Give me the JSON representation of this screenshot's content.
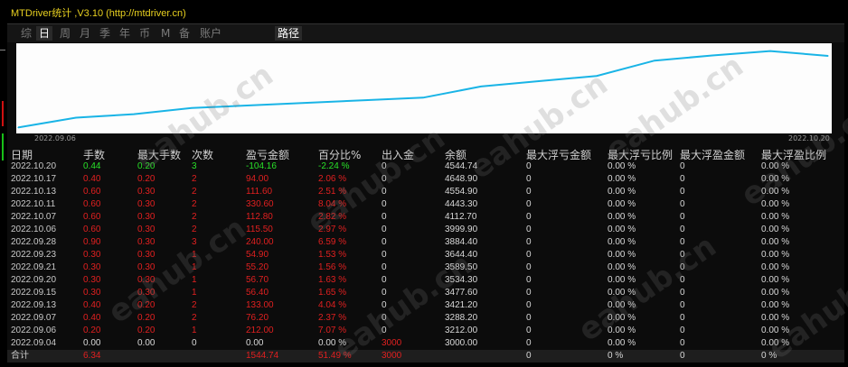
{
  "window": {
    "title": "MTDriver统计 ,V3.10 (http://mtdriver.cn)"
  },
  "tabs": [
    {
      "label": "综",
      "active": false
    },
    {
      "label": "日",
      "active": true
    },
    {
      "label": "周",
      "active": false
    },
    {
      "label": "月",
      "active": false
    },
    {
      "label": "季",
      "active": false
    },
    {
      "label": "年",
      "active": false
    },
    {
      "label": "币",
      "active": false
    },
    {
      "label": "M",
      "active": false
    },
    {
      "label": "备",
      "active": false
    },
    {
      "label": "账户",
      "active": false
    },
    {
      "label": "路径",
      "active": true
    }
  ],
  "chart": {
    "start_label": "2022.09.06",
    "end_label": "2022.10.20",
    "line_color": "#19b4e6",
    "chart_data": {
      "type": "line",
      "x": [
        "2022.09.04",
        "2022.09.06",
        "2022.09.07",
        "2022.09.13",
        "2022.09.15",
        "2022.09.20",
        "2022.09.21",
        "2022.09.23",
        "2022.09.28",
        "2022.10.06",
        "2022.10.07",
        "2022.10.11",
        "2022.10.13",
        "2022.10.17",
        "2022.10.20"
      ],
      "series": [
        {
          "values": [
            3000.0,
            3212.0,
            3288.2,
            3421.2,
            3477.6,
            3534.3,
            3589.5,
            3644.4,
            3884.4,
            3999.9,
            4112.7,
            4443.3,
            4554.9,
            4648.9,
            4544.74
          ]
        }
      ]
    }
  },
  "table": {
    "headers": [
      "日期",
      "手数",
      "最大手数",
      "次数",
      "盈亏金额",
      "百分比%",
      "出入金",
      "余额",
      "最大浮亏金额",
      "最大浮亏比例",
      "最大浮盈金额",
      "最大浮盈比例"
    ],
    "rows": [
      {
        "date": "2022.10.20",
        "lots": "0.44",
        "max_lots": "0.20",
        "count": "3",
        "pnl": "-104.16",
        "pct": "-2.24 %",
        "deposit": "0",
        "balance": "4544.74",
        "max_float_loss": "0",
        "max_float_loss_pct": "0.00 %",
        "max_float_profit": "0",
        "max_float_profit_pct": "0.00 %",
        "tone": "green"
      },
      {
        "date": "2022.10.17",
        "lots": "0.40",
        "max_lots": "0.20",
        "count": "2",
        "pnl": "94.00",
        "pct": "2.06 %",
        "deposit": "0",
        "balance": "4648.90",
        "max_float_loss": "0",
        "max_float_loss_pct": "0.00 %",
        "max_float_profit": "0",
        "max_float_profit_pct": "0.00 %",
        "tone": "red"
      },
      {
        "date": "2022.10.13",
        "lots": "0.60",
        "max_lots": "0.30",
        "count": "2",
        "pnl": "111.60",
        "pct": "2.51 %",
        "deposit": "0",
        "balance": "4554.90",
        "max_float_loss": "0",
        "max_float_loss_pct": "0.00 %",
        "max_float_profit": "0",
        "max_float_profit_pct": "0.00 %",
        "tone": "red"
      },
      {
        "date": "2022.10.11",
        "lots": "0.60",
        "max_lots": "0.30",
        "count": "2",
        "pnl": "330.60",
        "pct": "8.04 %",
        "deposit": "0",
        "balance": "4443.30",
        "max_float_loss": "0",
        "max_float_loss_pct": "0.00 %",
        "max_float_profit": "0",
        "max_float_profit_pct": "0.00 %",
        "tone": "red"
      },
      {
        "date": "2022.10.07",
        "lots": "0.60",
        "max_lots": "0.30",
        "count": "2",
        "pnl": "112.80",
        "pct": "2.82 %",
        "deposit": "0",
        "balance": "4112.70",
        "max_float_loss": "0",
        "max_float_loss_pct": "0.00 %",
        "max_float_profit": "0",
        "max_float_profit_pct": "0.00 %",
        "tone": "red"
      },
      {
        "date": "2022.10.06",
        "lots": "0.60",
        "max_lots": "0.30",
        "count": "2",
        "pnl": "115.50",
        "pct": "2.97 %",
        "deposit": "0",
        "balance": "3999.90",
        "max_float_loss": "0",
        "max_float_loss_pct": "0.00 %",
        "max_float_profit": "0",
        "max_float_profit_pct": "0.00 %",
        "tone": "red"
      },
      {
        "date": "2022.09.28",
        "lots": "0.90",
        "max_lots": "0.30",
        "count": "3",
        "pnl": "240.00",
        "pct": "6.59 %",
        "deposit": "0",
        "balance": "3884.40",
        "max_float_loss": "0",
        "max_float_loss_pct": "0.00 %",
        "max_float_profit": "0",
        "max_float_profit_pct": "0.00 %",
        "tone": "red"
      },
      {
        "date": "2022.09.23",
        "lots": "0.30",
        "max_lots": "0.30",
        "count": "1",
        "pnl": "54.90",
        "pct": "1.53 %",
        "deposit": "0",
        "balance": "3644.40",
        "max_float_loss": "0",
        "max_float_loss_pct": "0.00 %",
        "max_float_profit": "0",
        "max_float_profit_pct": "0.00 %",
        "tone": "red"
      },
      {
        "date": "2022.09.21",
        "lots": "0.30",
        "max_lots": "0.30",
        "count": "1",
        "pnl": "55.20",
        "pct": "1.56 %",
        "deposit": "0",
        "balance": "3589.50",
        "max_float_loss": "0",
        "max_float_loss_pct": "0.00 %",
        "max_float_profit": "0",
        "max_float_profit_pct": "0.00 %",
        "tone": "red"
      },
      {
        "date": "2022.09.20",
        "lots": "0.30",
        "max_lots": "0.30",
        "count": "1",
        "pnl": "56.70",
        "pct": "1.63 %",
        "deposit": "0",
        "balance": "3534.30",
        "max_float_loss": "0",
        "max_float_loss_pct": "0.00 %",
        "max_float_profit": "0",
        "max_float_profit_pct": "0.00 %",
        "tone": "red"
      },
      {
        "date": "2022.09.15",
        "lots": "0.30",
        "max_lots": "0.30",
        "count": "1",
        "pnl": "56.40",
        "pct": "1.65 %",
        "deposit": "0",
        "balance": "3477.60",
        "max_float_loss": "0",
        "max_float_loss_pct": "0.00 %",
        "max_float_profit": "0",
        "max_float_profit_pct": "0.00 %",
        "tone": "red"
      },
      {
        "date": "2022.09.13",
        "lots": "0.40",
        "max_lots": "0.20",
        "count": "2",
        "pnl": "133.00",
        "pct": "4.04 %",
        "deposit": "0",
        "balance": "3421.20",
        "max_float_loss": "0",
        "max_float_loss_pct": "0.00 %",
        "max_float_profit": "0",
        "max_float_profit_pct": "0.00 %",
        "tone": "red"
      },
      {
        "date": "2022.09.07",
        "lots": "0.40",
        "max_lots": "0.20",
        "count": "2",
        "pnl": "76.20",
        "pct": "2.37 %",
        "deposit": "0",
        "balance": "3288.20",
        "max_float_loss": "0",
        "max_float_loss_pct": "0.00 %",
        "max_float_profit": "0",
        "max_float_profit_pct": "0.00 %",
        "tone": "red"
      },
      {
        "date": "2022.09.06",
        "lots": "0.20",
        "max_lots": "0.20",
        "count": "1",
        "pnl": "212.00",
        "pct": "7.07 %",
        "deposit": "0",
        "balance": "3212.00",
        "max_float_loss": "0",
        "max_float_loss_pct": "0.00 %",
        "max_float_profit": "0",
        "max_float_profit_pct": "0.00 %",
        "tone": "red"
      },
      {
        "date": "2022.09.04",
        "lots": "0.00",
        "max_lots": "0.00",
        "count": "0",
        "pnl": "0.00",
        "pct": "0.00 %",
        "deposit": "3000",
        "balance": "3000.00",
        "max_float_loss": "0",
        "max_float_loss_pct": "0.00 %",
        "max_float_profit": "0",
        "max_float_profit_pct": "0.00 %",
        "tone": "white"
      }
    ],
    "total": {
      "label": "合计",
      "lots": "6.34",
      "pnl": "1544.74",
      "pct": "51.49 %",
      "deposit": "3000",
      "max_float_loss": "0",
      "max_float_loss_pct": "0 %",
      "max_float_profit": "0",
      "max_float_profit_pct": "0 %"
    }
  },
  "watermark": "eahub.cn"
}
